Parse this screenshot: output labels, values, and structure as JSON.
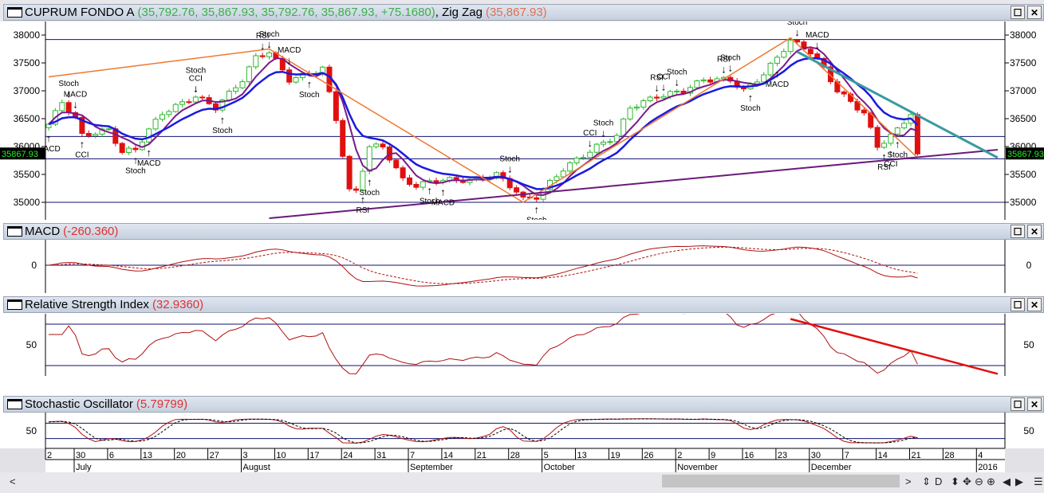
{
  "panels": {
    "main": {
      "title": "CUPRUM FONDO A",
      "values": "(35,792.76, 35,867.93, 35,792.76, 35,867.93, +75.1680)",
      "zz_label": ", Zig Zag",
      "zz_value": "(35,867.93)"
    },
    "macd": {
      "title": "MACD",
      "value": "(-260.360)"
    },
    "rsi": {
      "title": "Relative Strength Index",
      "value": "(32.9360)"
    },
    "stoch": {
      "title": "Stochastic Oscillator",
      "value": "(5.79799)"
    }
  },
  "window_buttons": {
    "maximize": "☐",
    "close": "✕"
  },
  "toolbar": {
    "scroll_left": "<",
    "scroll_right": ">",
    "icons": [
      "⇕",
      "D",
      "⬍",
      "✥",
      "⊖",
      "⊕",
      "◀",
      "▶",
      "☰"
    ]
  },
  "colors": {
    "up": "#2eb82e",
    "down": "#e01010",
    "ma_fast": "#7a1a8c",
    "ma_slow": "#1a1ae0",
    "zigzag": "#f07830",
    "trend_support": "#6a1a7a",
    "trend_resist": "#3a9aa0",
    "last_price_bg": "#000000",
    "last_price_fg": "#22ee22",
    "indicator": "#b01010"
  },
  "chart_data": {
    "type": "candlestick",
    "title": "CUPRUM FONDO A",
    "ylim": [
      34700,
      38250
    ],
    "y_ticks": [
      "35000",
      "35500",
      "36000",
      "36500",
      "37000",
      "37500",
      "38000"
    ],
    "last_price": "35867.93",
    "close_keypoints": [
      [
        0,
        36400
      ],
      [
        2,
        36800
      ],
      [
        4,
        36500
      ],
      [
        5,
        36200
      ],
      [
        9,
        36300
      ],
      [
        11,
        35900
      ],
      [
        13,
        35950
      ],
      [
        15,
        36300
      ],
      [
        17,
        36600
      ],
      [
        22,
        36900
      ],
      [
        25,
        36700
      ],
      [
        29,
        37200
      ],
      [
        31,
        37600
      ],
      [
        33,
        37700
      ],
      [
        36,
        37200
      ],
      [
        39,
        37300
      ],
      [
        41,
        37400
      ],
      [
        43,
        36500
      ],
      [
        45,
        35200
      ],
      [
        46,
        35200
      ],
      [
        48,
        36000
      ],
      [
        50,
        36000
      ],
      [
        53,
        35400
      ],
      [
        55,
        35300
      ],
      [
        58,
        35400
      ],
      [
        60,
        35400
      ],
      [
        64,
        35400
      ],
      [
        67,
        35500
      ],
      [
        70,
        35200
      ],
      [
        71,
        35050
      ],
      [
        73,
        35100
      ],
      [
        77,
        35600
      ],
      [
        82,
        36000
      ],
      [
        85,
        36200
      ],
      [
        87,
        36700
      ],
      [
        91,
        36900
      ],
      [
        95,
        37000
      ],
      [
        98,
        37200
      ],
      [
        102,
        37200
      ],
      [
        104,
        37000
      ],
      [
        107,
        37300
      ],
      [
        109,
        37600
      ],
      [
        111,
        37900
      ],
      [
        114,
        37700
      ],
      [
        116,
        37400
      ],
      [
        118,
        37000
      ],
      [
        122,
        36600
      ],
      [
        124,
        36000
      ],
      [
        127,
        36300
      ],
      [
        129,
        36600
      ],
      [
        130,
        35868
      ]
    ],
    "zigzag": [
      [
        0,
        37250
      ],
      [
        33,
        37750
      ],
      [
        71,
        35000
      ],
      [
        111,
        37950
      ],
      [
        130,
        35800
      ]
    ],
    "horizontal_lines": [
      37920,
      36180,
      35780,
      35000
    ],
    "trendlines": [
      {
        "name": "support",
        "from": [
          33,
          34714
        ],
        "to": [
          142,
          35943
        ]
      },
      {
        "name": "resistance",
        "from": [
          112,
          37700
        ],
        "to": [
          142,
          35800
        ]
      }
    ],
    "signals": [
      {
        "day": 3,
        "label": "Stoch",
        "dir": "sell"
      },
      {
        "day": 4,
        "label": "MACD",
        "dir": "sell"
      },
      {
        "day": 0,
        "label": "MACD",
        "dir": "buy"
      },
      {
        "day": 5,
        "label": "CCI",
        "dir": "buy"
      },
      {
        "day": 13,
        "label": "Stoch",
        "dir": "buy"
      },
      {
        "day": 15,
        "label": "MACD",
        "dir": "buy"
      },
      {
        "day": 22,
        "label": "CCI",
        "dir": "sell"
      },
      {
        "day": 22,
        "label": "Stoch",
        "dir": "sell"
      },
      {
        "day": 26,
        "label": "Stoch",
        "dir": "buy"
      },
      {
        "day": 32,
        "label": "RSI",
        "dir": "sell"
      },
      {
        "day": 33,
        "label": "Stoch",
        "dir": "sell"
      },
      {
        "day": 36,
        "label": "MACD",
        "dir": "sell"
      },
      {
        "day": 39,
        "label": "Stoch",
        "dir": "buy"
      },
      {
        "day": 47,
        "label": "RSI",
        "dir": "buy"
      },
      {
        "day": 48,
        "label": "Stoch",
        "dir": "buy"
      },
      {
        "day": 57,
        "label": "Stoch",
        "dir": "buy"
      },
      {
        "day": 59,
        "label": "MACD",
        "dir": "buy"
      },
      {
        "day": 69,
        "label": "Stoch",
        "dir": "sell"
      },
      {
        "day": 73,
        "label": "Stoch",
        "dir": "buy"
      },
      {
        "day": 81,
        "label": "CCI",
        "dir": "sell"
      },
      {
        "day": 83,
        "label": "Stoch",
        "dir": "sell"
      },
      {
        "day": 91,
        "label": "RSI",
        "dir": "sell"
      },
      {
        "day": 92,
        "label": "CCI",
        "dir": "sell"
      },
      {
        "day": 94,
        "label": "Stoch",
        "dir": "sell"
      },
      {
        "day": 101,
        "label": "RSI",
        "dir": "sell"
      },
      {
        "day": 102,
        "label": "Stoch",
        "dir": "sell"
      },
      {
        "day": 105,
        "label": "Stoch",
        "dir": "buy"
      },
      {
        "day": 109,
        "label": "MACD",
        "dir": "buy"
      },
      {
        "day": 112,
        "label": "Stoch",
        "dir": "sell"
      },
      {
        "day": 115,
        "label": "MACD",
        "dir": "sell"
      },
      {
        "day": 125,
        "label": "RSI",
        "dir": "buy"
      },
      {
        "day": 126,
        "label": "CCI",
        "dir": "buy"
      },
      {
        "day": 127,
        "label": "Stoch",
        "dir": "buy"
      }
    ],
    "x_ticks": [
      "2",
      "30",
      "6",
      "13",
      "20",
      "27",
      "3",
      "10",
      "17",
      "24",
      "31",
      "7",
      "14",
      "21",
      "28",
      "5",
      "13",
      "19",
      "26",
      "2",
      "9",
      "16",
      "23",
      "30",
      "7",
      "14",
      "21",
      "28",
      "4"
    ],
    "x_months": [
      {
        "tick": 1,
        "label": "July"
      },
      {
        "tick": 6,
        "label": "August"
      },
      {
        "tick": 11,
        "label": "September"
      },
      {
        "tick": 15,
        "label": "October"
      },
      {
        "tick": 19,
        "label": "November"
      },
      {
        "tick": 23,
        "label": "December"
      },
      {
        "tick": 28,
        "label": "2016"
      }
    ],
    "macd": {
      "zero_label": "0",
      "current": -260.36
    },
    "rsi": {
      "levels": [
        70,
        30
      ],
      "tick_label": "50",
      "trendline": {
        "from": [
          111,
          75
        ],
        "to": [
          142,
          22
        ]
      },
      "current": 32.936
    },
    "stoch": {
      "levels": [
        80,
        20
      ],
      "tick_label": "50",
      "current": 5.79799
    }
  }
}
